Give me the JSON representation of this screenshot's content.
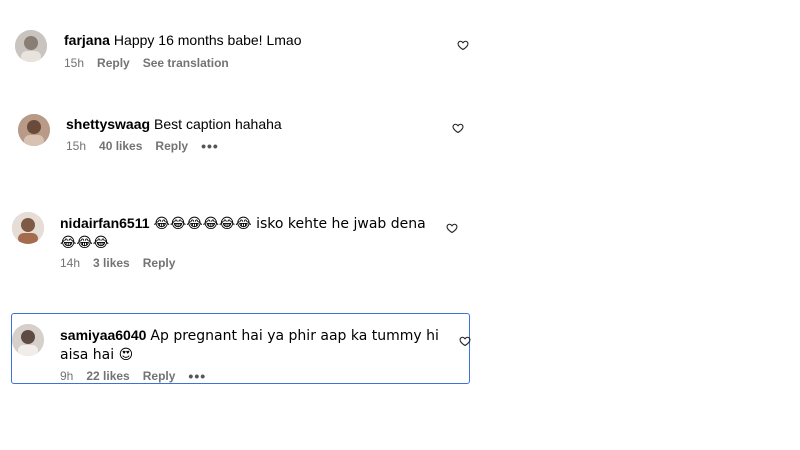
{
  "comments": [
    {
      "username": "farjana",
      "text": "Happy 16 months babe! Lmao",
      "time": "15h",
      "likes": "",
      "reply": "Reply",
      "extra": "See translation"
    },
    {
      "username": "shettyswaag",
      "text": "Best caption hahaha",
      "time": "15h",
      "likes": "40 likes",
      "reply": "Reply",
      "more": "•••"
    },
    {
      "username": "nidairfan6511",
      "text": "😂😂😂😂😂😂 isko kehte he jwab dena😂😂😂",
      "time": "14h",
      "likes": "3 likes",
      "reply": "Reply"
    },
    {
      "username": "samiyaa6040",
      "text": "Ap pregnant hai ya phir aap ka tummy hi aisa hai 😍",
      "time": "9h",
      "likes": "22 likes",
      "reply": "Reply",
      "more": "•••"
    }
  ],
  "icons": {
    "like": "heart-outline-icon"
  },
  "colors": {
    "selection_border": "#3d72dc",
    "meta_text": "#737373"
  }
}
